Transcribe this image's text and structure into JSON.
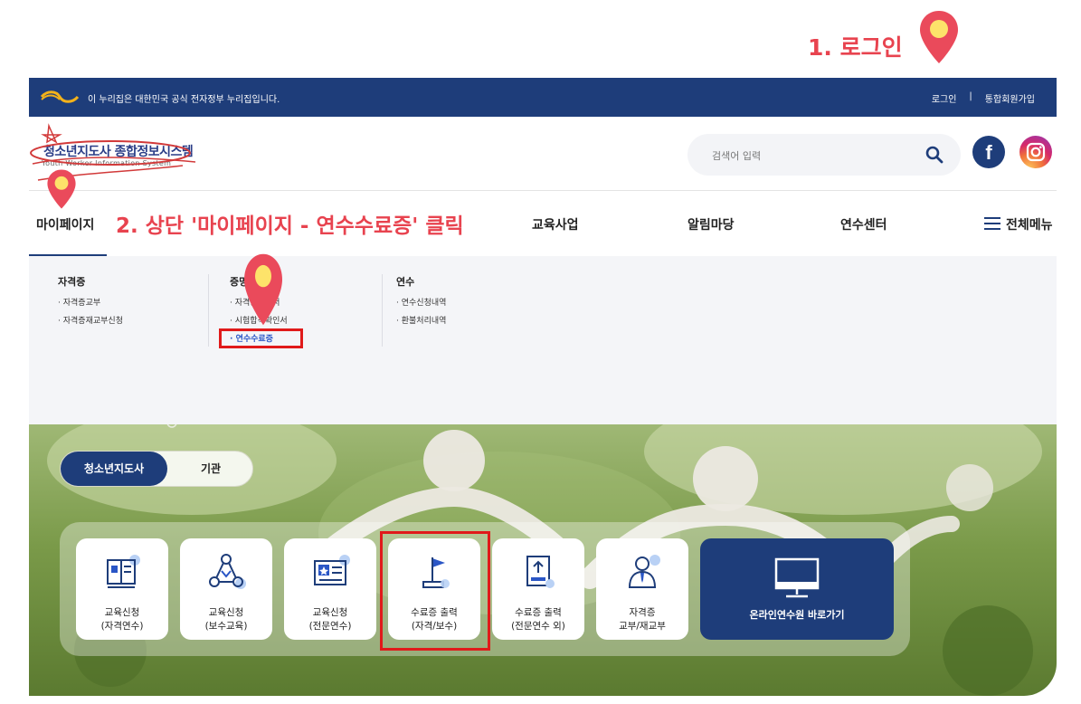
{
  "annotations": {
    "step1": "1. 로그인",
    "step2": "2. 상단 '마이페이지 - 연수수료증' 클릭"
  },
  "gov_bar": {
    "text": "이 누리집은 대한민국 공식 전자정부 누리집입니다.",
    "login": "로그인",
    "divider": "|",
    "signup": "통합회원가입"
  },
  "header": {
    "logo_title": "청소년지도사 종합정보시스템",
    "logo_subtitle": "Youth Worker Information System",
    "search_placeholder": "검색어 입력",
    "social": [
      "facebook-icon",
      "instagram-icon"
    ]
  },
  "nav": {
    "items": [
      "마이페이지",
      "교육사업",
      "알림마당",
      "연수센터"
    ],
    "all_menu": "전체메뉴"
  },
  "dropdown": {
    "columns": [
      {
        "title": "자격증",
        "items": [
          "자격증교부",
          "자격증재교부신청"
        ]
      },
      {
        "title": "증명서",
        "items": [
          "자격증확인서",
          "시험합격확인서",
          "연수수료증"
        ]
      },
      {
        "title": "연수",
        "items": [
          "연수신청내역",
          "환불처리내역"
        ]
      }
    ],
    "active_item": "연수수료증"
  },
  "hero": {
    "toggle": {
      "active": "청소년지도사",
      "inactive": "기관"
    },
    "quick_links": [
      {
        "line1": "교육신청",
        "line2": "(자격연수)",
        "icon": "book-icon"
      },
      {
        "line1": "교육신청",
        "line2": "(보수교육)",
        "icon": "network-icon"
      },
      {
        "line1": "교육신청",
        "line2": "(전문연수)",
        "icon": "certificate-star-icon"
      },
      {
        "line1": "수료증 출력",
        "line2": "(자격/보수)",
        "icon": "flag-icon"
      },
      {
        "line1": "수료증 출력",
        "line2": "(전문연수 외)",
        "icon": "upload-doc-icon"
      },
      {
        "line1": "자격증",
        "line2": "교부/재교부",
        "icon": "person-tie-icon"
      }
    ],
    "online_button": "온라인연수원 바로가기"
  },
  "colors": {
    "navy": "#1e3d7a",
    "annotation_red": "#e8434f",
    "highlight_red": "#e01a1a",
    "active_link": "#2a56c6"
  }
}
